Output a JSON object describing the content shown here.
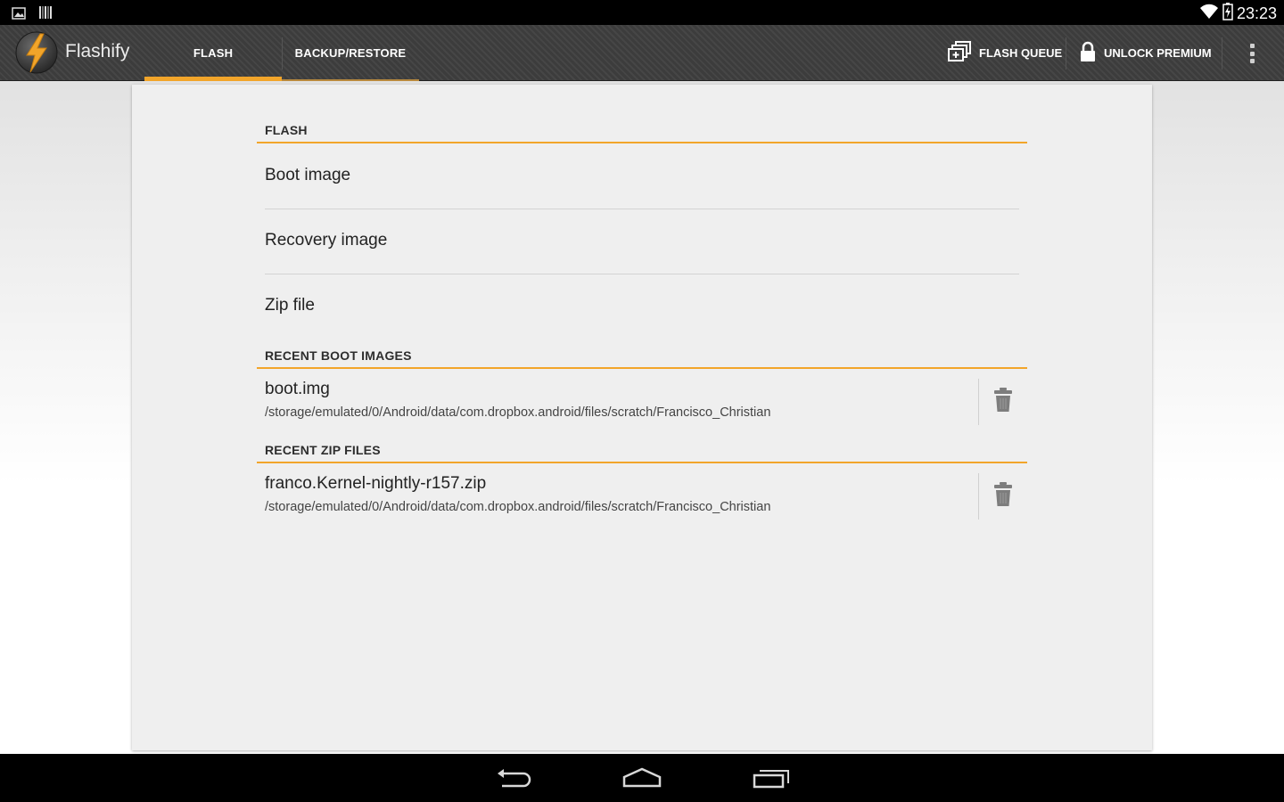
{
  "status_bar": {
    "time": "23:23",
    "left_icons": [
      "image-notification-icon",
      "barcode-notification-icon"
    ],
    "right_icons": [
      "wifi-icon",
      "battery-charging-icon"
    ]
  },
  "app": {
    "title": "Flashify",
    "logo_icon": "lightning-bolt-icon",
    "accent_color": "#f2a52a"
  },
  "tabs": [
    {
      "label": "FLASH",
      "selected": true
    },
    {
      "label": "BACKUP/RESTORE",
      "selected": false
    }
  ],
  "actions": {
    "flash_queue": {
      "label": "FLASH QUEUE",
      "icon": "queue-add-icon"
    },
    "unlock_premium": {
      "label": "UNLOCK PREMIUM",
      "icon": "lock-icon"
    },
    "overflow_icon": "overflow-menu-icon"
  },
  "flash_section": {
    "header": "FLASH",
    "items": [
      {
        "label": "Boot image"
      },
      {
        "label": "Recovery image"
      },
      {
        "label": "Zip file"
      }
    ]
  },
  "recent_boot_images": {
    "header": "RECENT BOOT IMAGES",
    "items": [
      {
        "name": "boot.img",
        "path": "/storage/emulated/0/Android/data/com.dropbox.android/files/scratch/Francisco_Christian",
        "action_icon": "trash-icon"
      }
    ]
  },
  "recent_zip_files": {
    "header": "RECENT ZIP FILES",
    "items": [
      {
        "name": "franco.Kernel-nightly-r157.zip",
        "path": "/storage/emulated/0/Android/data/com.dropbox.android/files/scratch/Francisco_Christian",
        "action_icon": "trash-icon"
      }
    ]
  },
  "nav_bar": {
    "buttons": [
      "back-icon",
      "home-icon",
      "recent-apps-icon"
    ]
  }
}
